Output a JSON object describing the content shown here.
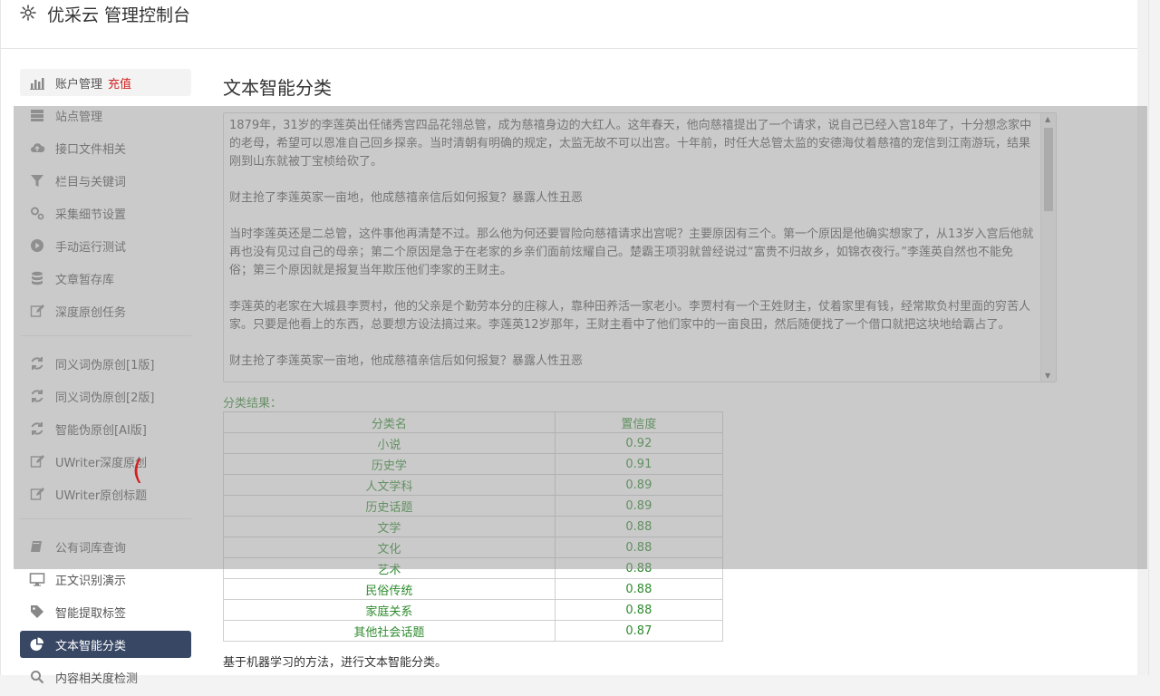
{
  "header": {
    "title": "优采云 管理控制台",
    "icon": "gear-icon"
  },
  "sidebar": {
    "group1": [
      {
        "label": "账户管理",
        "badge": "充值",
        "icon": "bar-chart-icon"
      },
      {
        "label": "站点管理",
        "icon": "server-icon"
      },
      {
        "label": "接口文件相关",
        "icon": "cloud-upload-icon"
      },
      {
        "label": "栏目与关键词",
        "icon": "filter-icon"
      },
      {
        "label": "采集细节设置",
        "icon": "cogs-icon"
      },
      {
        "label": "手动运行测试",
        "icon": "play-circle-icon"
      },
      {
        "label": "文章暂存库",
        "icon": "database-icon"
      },
      {
        "label": "深度原创任务",
        "icon": "edit-icon"
      }
    ],
    "group2": [
      {
        "label": "同义词伪原创[1版]",
        "icon": "refresh-icon"
      },
      {
        "label": "同义词伪原创[2版]",
        "icon": "refresh-icon"
      },
      {
        "label": "智能伪原创[AI版]",
        "icon": "refresh-icon"
      },
      {
        "label": "UWriter深度原创",
        "icon": "edit-icon"
      },
      {
        "label": "UWriter原创标题",
        "icon": "edit-icon"
      }
    ],
    "group3": [
      {
        "label": "公有词库查询",
        "icon": "book-icon"
      },
      {
        "label": "正文识别演示",
        "icon": "monitor-icon"
      },
      {
        "label": "智能提取标签",
        "icon": "tag-icon"
      },
      {
        "label": "文本智能分类",
        "icon": "pie-chart-icon"
      },
      {
        "label": "内容相关度检测",
        "icon": "search-icon"
      }
    ]
  },
  "main": {
    "title": "文本智能分类",
    "text_paragraphs": [
      "1879年，31岁的李莲英出任储秀宫四品花翎总管，成为慈禧身边的大红人。这年春天，他向慈禧提出了一个请求，说自己已经入宫18年了，十分想念家中的老母，希望可以恩准自己回乡探亲。当时清朝有明确的规定，太监无故不可以出宫。十年前，时任大总管太监的安德海仗着慈禧的宠信到江南游玩，结果刚到山东就被丁宝桢给砍了。",
      "财主抢了李莲英家一亩地，他成慈禧亲信后如何报复？暴露人性丑恶",
      "当时李莲英还是二总管，这件事他再清楚不过。那么他为何还要冒险向慈禧请求出宫呢？主要原因有三个。第一个原因是他确实想家了，从13岁入宫后他就再也没有见过自己的母亲；第二个原因是急于在老家的乡亲们面前炫耀自己。楚霸王项羽就曾经说过“富贵不归故乡，如锦衣夜行。”李莲英自然也不能免俗；第三个原因就是报复当年欺压他们李家的王财主。",
      "李莲英的老家在大城县李贾村，他的父亲是个勤劳本分的庄稼人，靠种田养活一家老小。李贾村有一个王姓财主，仗着家里有钱，经常欺负村里面的穷苦人家。只要是他看上的东西，总要想方设法搞过来。李莲英12岁那年，王财主看中了他们家中的一亩良田，然后随便找了一个借口就把这块地给霸占了。",
      "财主抢了李莲英家一亩地，他成慈禧亲信后如何报复？暴露人性丑恶"
    ],
    "result_label": "分类结果：",
    "table": {
      "headers": [
        "分类名",
        "置信度"
      ],
      "rows": [
        [
          "小说",
          "0.92"
        ],
        [
          "历史学",
          "0.91"
        ],
        [
          "人文学科",
          "0.89"
        ],
        [
          "历史话题",
          "0.89"
        ],
        [
          "文学",
          "0.88"
        ],
        [
          "文化",
          "0.88"
        ],
        [
          "艺术",
          "0.88"
        ],
        [
          "民俗传统",
          "0.88"
        ],
        [
          "家庭关系",
          "0.88"
        ],
        [
          "其他社会话题",
          "0.87"
        ]
      ]
    },
    "description": "基于机器学习的方法，进行文本智能分类。"
  },
  "loading": {
    "glyph": "("
  },
  "colors": {
    "active_bg": "#384764",
    "badge": "#d21f1f",
    "result_green": "#2e8b2e"
  }
}
